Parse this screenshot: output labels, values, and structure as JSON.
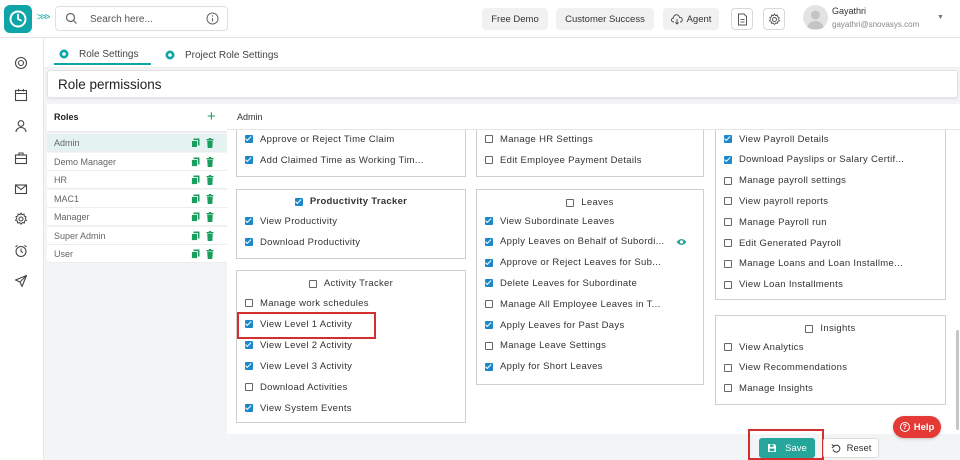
{
  "header": {
    "search_placeholder": "Search here...",
    "free_demo": "Free Demo",
    "customer_success": "Customer Success",
    "agent": "Agent",
    "user_name": "Gayathri",
    "user_email": "gayathri@snovasys.com"
  },
  "tabs": [
    {
      "label": "Role Settings",
      "active": true
    },
    {
      "label": "Project Role Settings",
      "active": false
    }
  ],
  "page_title": "Role permissions",
  "roles_panel": {
    "title": "Roles",
    "roles": [
      "Admin",
      "Demo Manager",
      "HR",
      "MAC1",
      "Manager",
      "Super Admin",
      "User"
    ],
    "selected": "Admin"
  },
  "selected_role": "Admin",
  "col1": {
    "top_items": [
      {
        "label": "Approve or Reject Time Claim",
        "checked": true
      },
      {
        "label": "Add Claimed Time as Working Tim...",
        "checked": true
      }
    ],
    "productivity": {
      "title": "Productivity Tracker",
      "checked": true,
      "items": [
        {
          "label": "View Productivity",
          "checked": true
        },
        {
          "label": "Download Productivity",
          "checked": true
        }
      ]
    },
    "activity": {
      "title": "Activity Tracker",
      "checked": false,
      "items": [
        {
          "label": "Manage work schedules",
          "checked": false
        },
        {
          "label": "View Level 1 Activity",
          "checked": true
        },
        {
          "label": "View Level 2 Activity",
          "checked": true
        },
        {
          "label": "View Level 3 Activity",
          "checked": true
        },
        {
          "label": "Download Activities",
          "checked": false
        },
        {
          "label": "View System Events",
          "checked": true
        }
      ]
    }
  },
  "col2": {
    "top_items": [
      {
        "label": "Manage HR Settings",
        "checked": false
      },
      {
        "label": "Edit Employee Payment Details",
        "checked": false
      }
    ],
    "leaves": {
      "title": "Leaves",
      "checked": false,
      "items": [
        {
          "label": "View Subordinate Leaves",
          "checked": true
        },
        {
          "label": "Apply Leaves on Behalf of Subordi...",
          "checked": true
        },
        {
          "label": "Approve or Reject Leaves for Sub...",
          "checked": true
        },
        {
          "label": "Delete Leaves for Subordinate",
          "checked": true
        },
        {
          "label": "Manage All Employee Leaves in T...",
          "checked": false
        },
        {
          "label": "Apply Leaves for Past Days",
          "checked": true
        },
        {
          "label": "Manage Leave Settings",
          "checked": false
        },
        {
          "label": "Apply for Short Leaves",
          "checked": true
        }
      ]
    }
  },
  "col3": {
    "payroll_items": [
      {
        "label": "View Payroll Details",
        "checked": true
      },
      {
        "label": "Download Payslips or Salary Certif...",
        "checked": true
      },
      {
        "label": "Manage payroll settings",
        "checked": false
      },
      {
        "label": "View payroll reports",
        "checked": false
      },
      {
        "label": "Manage Payroll run",
        "checked": false
      },
      {
        "label": "Edit Generated Payroll",
        "checked": false
      },
      {
        "label": "Manage Loans and Loan Installme...",
        "checked": false
      },
      {
        "label": "View Loan Installments",
        "checked": false
      }
    ],
    "insights": {
      "title": "Insights",
      "checked": false,
      "items": [
        {
          "label": "View Analytics",
          "checked": false
        },
        {
          "label": "View Recommendations",
          "checked": false
        },
        {
          "label": "Manage Insights",
          "checked": false
        }
      ]
    }
  },
  "footer": {
    "save_label": "Save",
    "reset_label": "Reset",
    "help_label": "Help"
  },
  "colors": {
    "accent": "#0ea5a8",
    "checkbox": "#1a88c9",
    "save": "#26a69a",
    "help": "#e53935",
    "highlight": "#d32f2f"
  },
  "icons": {
    "logo": "clock-logo-icon",
    "search": "search-icon",
    "info": "info-icon",
    "agent": "cloud-download-icon",
    "doc": "document-icon",
    "settings": "gear-icon",
    "avatar": "user-avatar-icon",
    "copy": "copy-icon",
    "delete": "trash-icon",
    "view": "eye-icon",
    "save": "save-icon",
    "reset": "undo-icon"
  }
}
